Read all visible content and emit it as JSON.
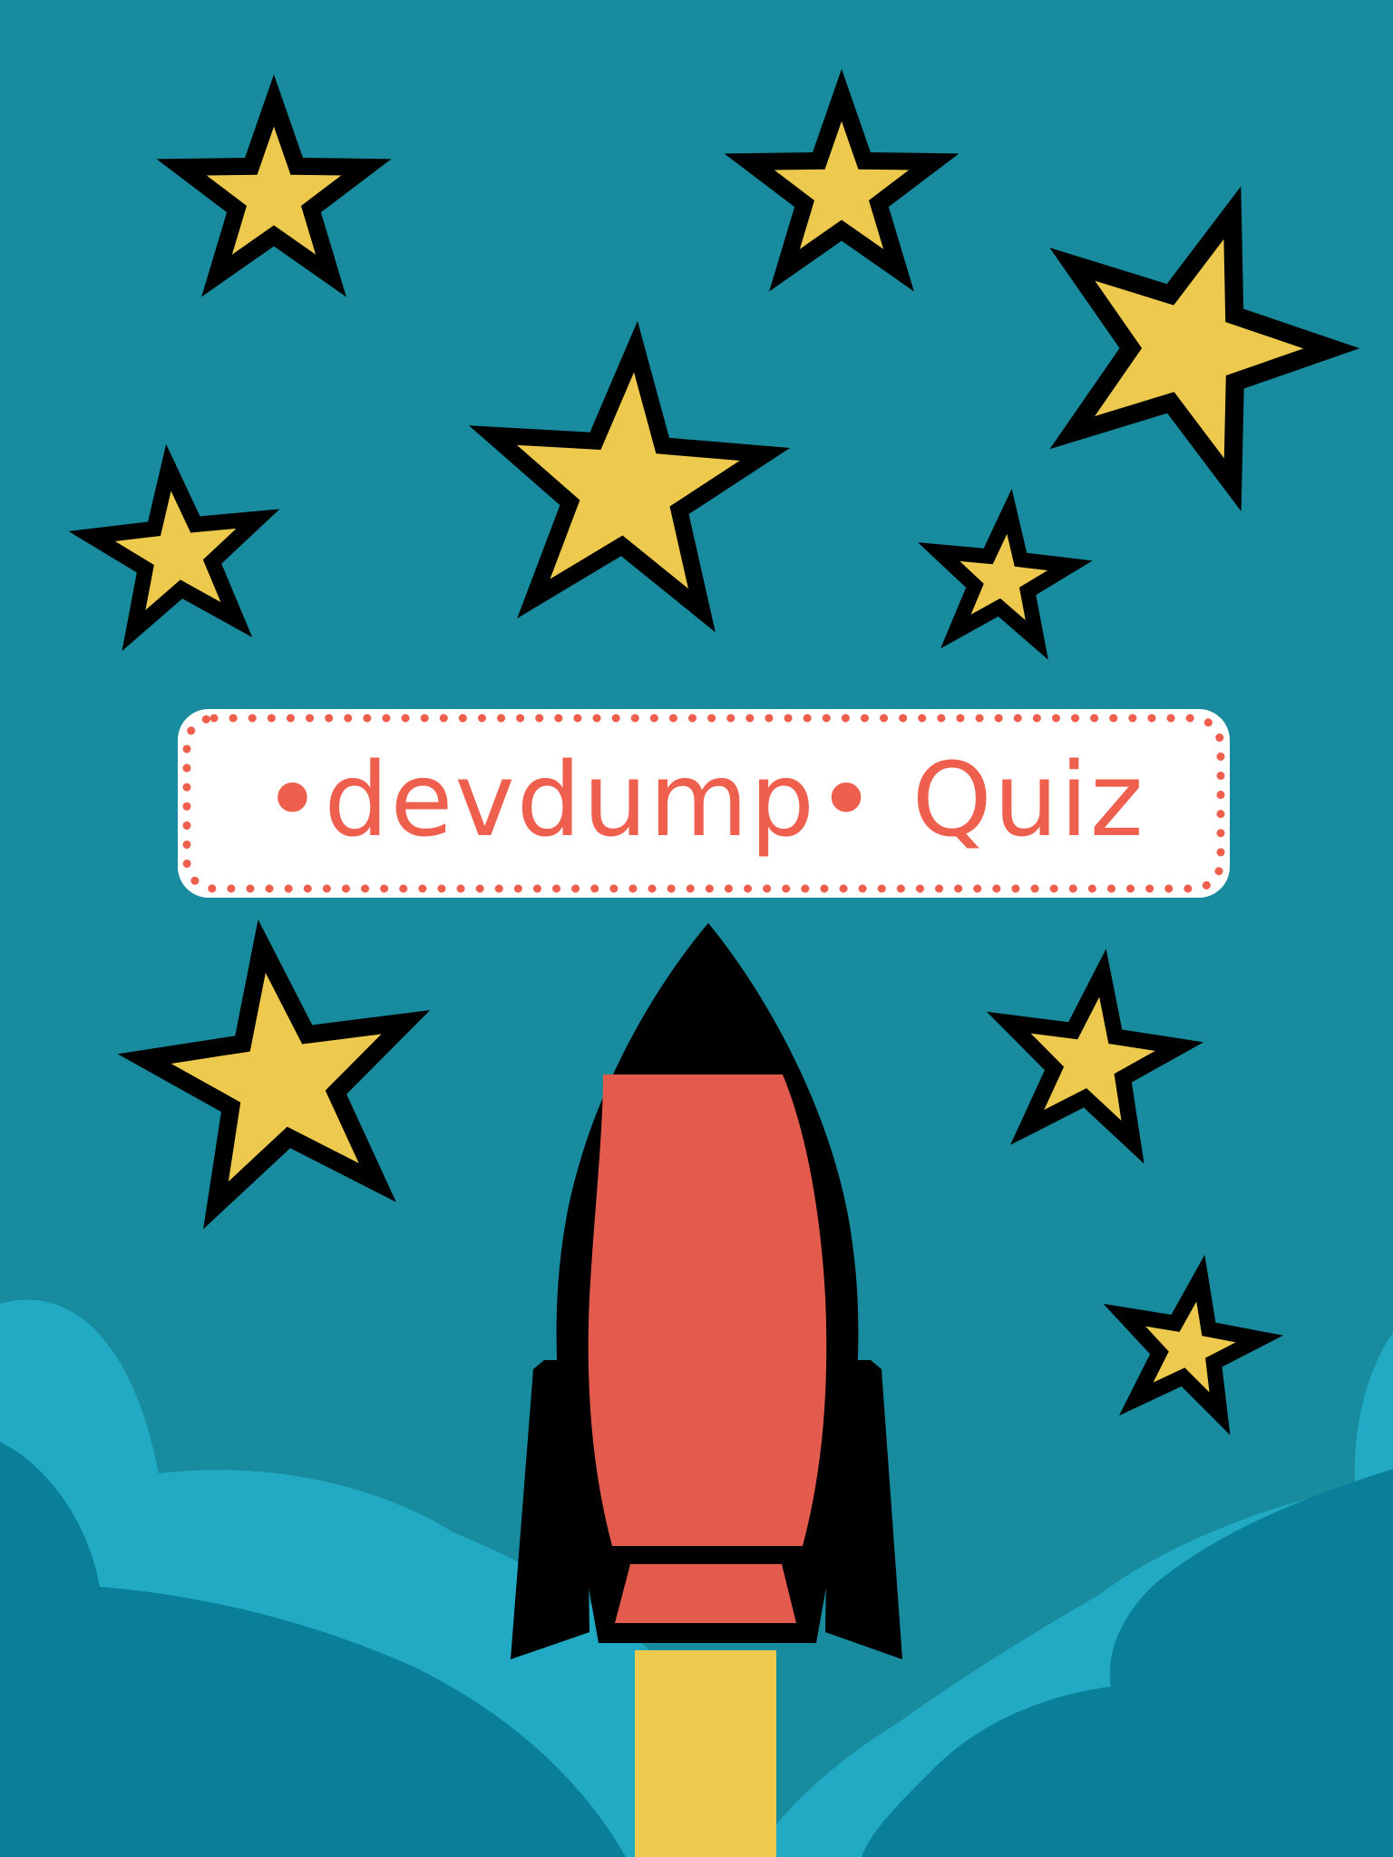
{
  "app": {
    "title_text": "•devdump• Quiz"
  },
  "colors": {
    "sky": "#188b9e",
    "cloud_light": "#22a9c3",
    "cloud_dark": "#0a7f99",
    "star_fill": "#edc94d",
    "star_outline": "#000000",
    "title_accent": "#ef5f4e",
    "title_background": "#ffffff",
    "rocket_body": "#e35b4d",
    "rocket_outline": "#000000",
    "rocket_flame": "#edc94d"
  },
  "icons": {
    "star": "star-icon",
    "rocket": "rocket-icon",
    "cloud": "cloud-icon"
  }
}
